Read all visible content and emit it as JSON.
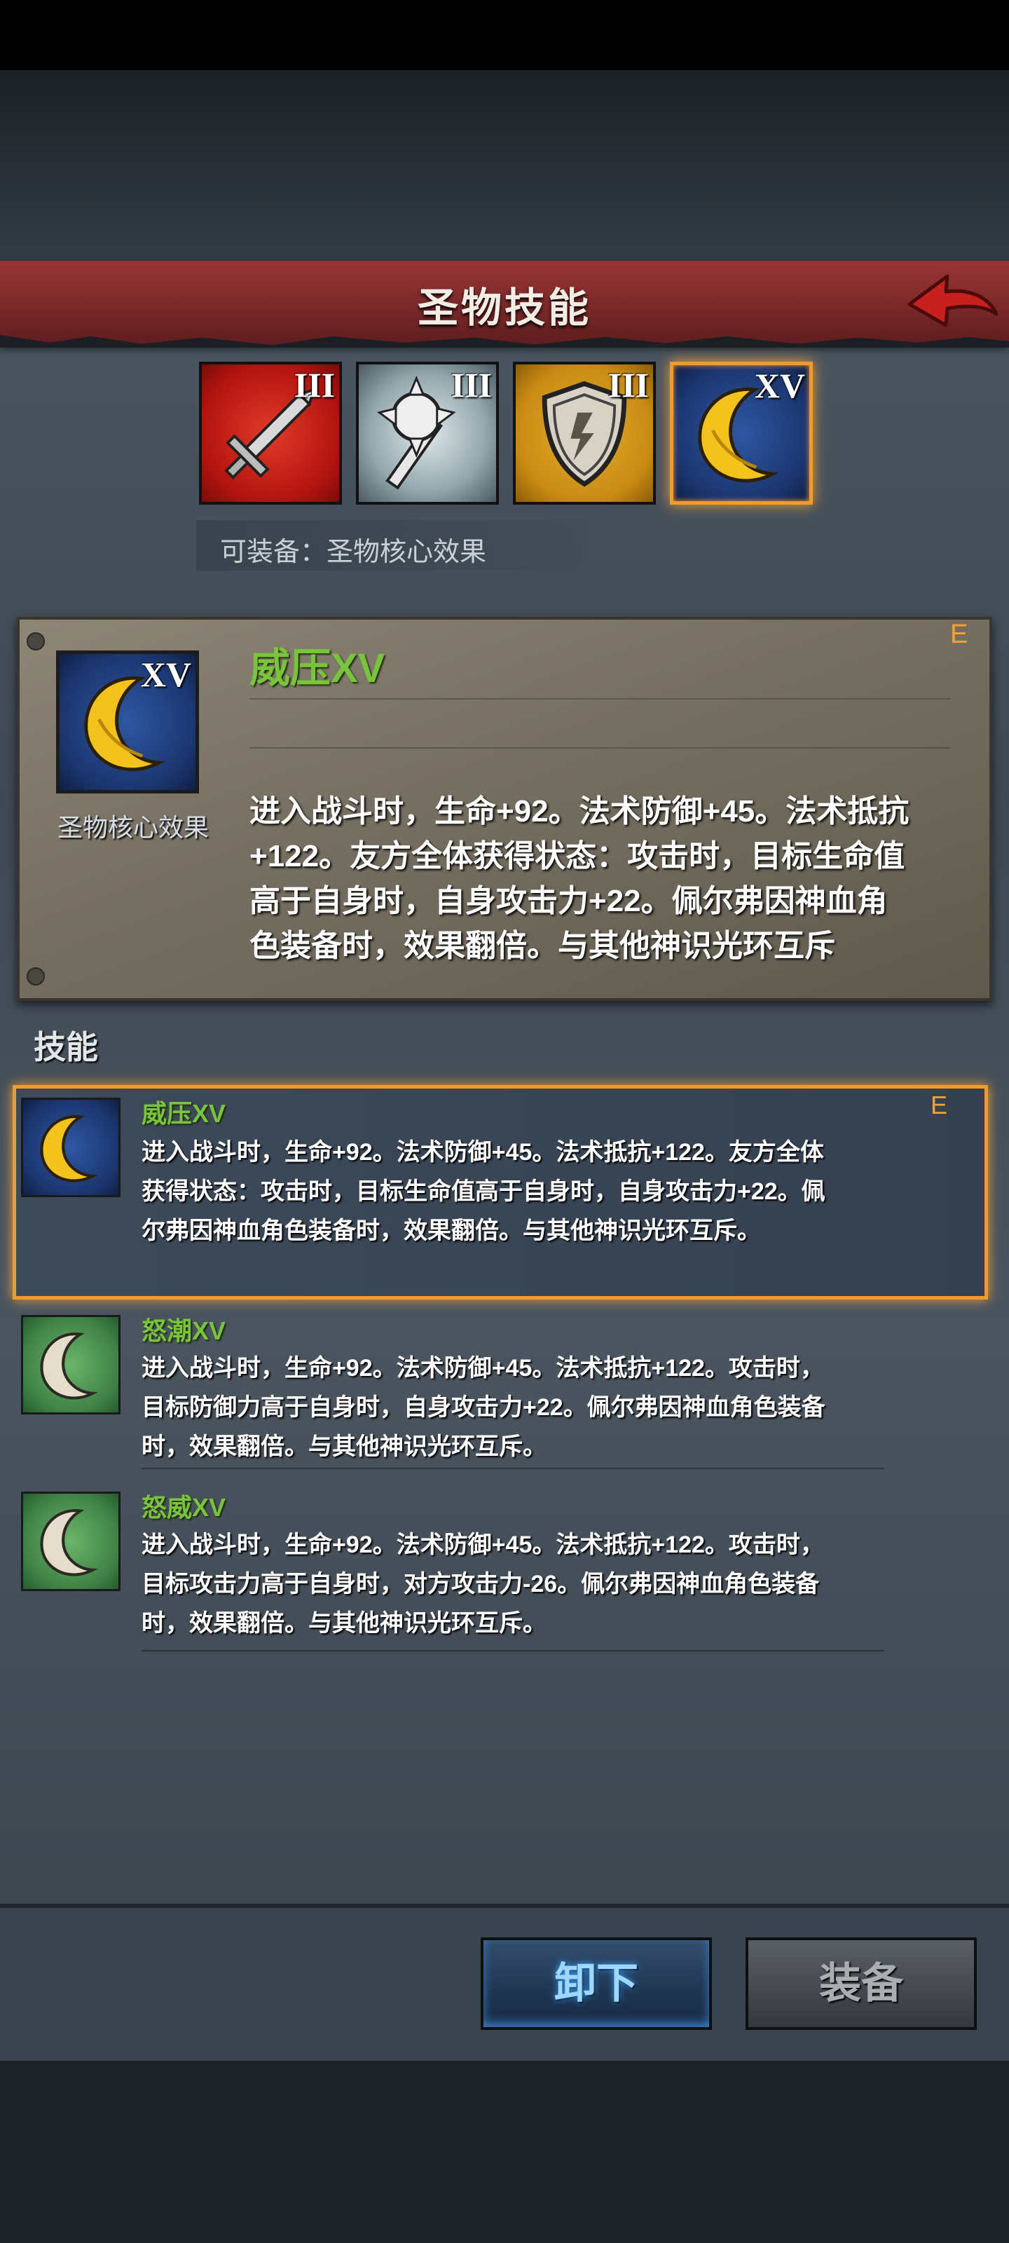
{
  "header": {
    "title": "圣物技能"
  },
  "tabs": [
    {
      "numeral": "III",
      "icon": "sword-icon"
    },
    {
      "numeral": "III",
      "icon": "spiked-mace-icon"
    },
    {
      "numeral": "III",
      "icon": "shield-icon"
    },
    {
      "numeral": "XV",
      "icon": "crescent-moon-icon",
      "selected": true
    }
  ],
  "equip_hint": "可装备：圣物核心效果",
  "card": {
    "numeral": "XV",
    "icon_label": "圣物核心效果",
    "title": "威压XV",
    "rarity": "E",
    "description": "进入战斗时，生命+92。法术防御+45。法术抵抗+122。友方全体获得状态：攻击时，目标生命值高于自身时，自身攻击力+22。佩尔弗因神血角色装备时，效果翻倍。与其他神识光环互斥"
  },
  "skills_header": "技能",
  "skills": [
    {
      "title": "威压XV",
      "rarity": "E",
      "description": "进入战斗时，生命+92。法术防御+45。法术抵抗+122。友方全体获得状态：攻击时，目标生命值高于自身时，自身攻击力+22。佩尔弗因神血角色装备时，效果翻倍。与其他神识光环互斥。"
    },
    {
      "title": "怒潮XV",
      "rarity": "",
      "description": "进入战斗时，生命+92。法术防御+45。法术抵抗+122。攻击时，目标防御力高于自身时，自身攻击力+22。佩尔弗因神血角色装备时，效果翻倍。与其他神识光环互斥。"
    },
    {
      "title": "怒威XV",
      "rarity": "",
      "description": "进入战斗时，生命+92。法术防御+45。法术抵抗+122。攻击时，目标攻击力高于自身时，对方攻击力-26。佩尔弗因神血角色装备时，效果翻倍。与其他神识光环互斥。"
    }
  ],
  "buttons": {
    "unequip": "卸下",
    "equip": "装备"
  },
  "colors": {
    "accent_orange": "#f39a2c",
    "skill_green": "#79c43a",
    "header_red": "#9a3535"
  }
}
